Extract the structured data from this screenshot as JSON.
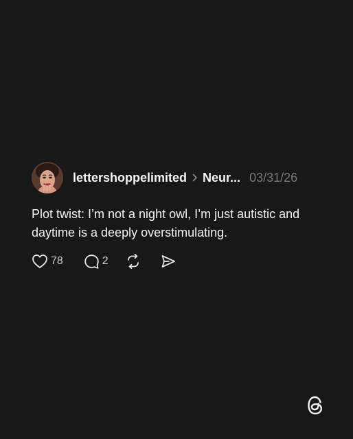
{
  "post": {
    "avatar_icon": "profile-photo",
    "username": "lettershoppelimited",
    "separator_icon": "chevron-right-icon",
    "community": "Neur...",
    "date": "03/31/26",
    "text": "Plot twist: I’m not a night owl, I’m just autistic and daytime is a deeply overstimulating.",
    "actions": {
      "like_icon": "heart-icon",
      "like_count": "78",
      "reply_icon": "comment-icon",
      "reply_count": "2",
      "repost_icon": "repost-icon",
      "share_icon": "share-icon"
    }
  },
  "branding": {
    "logo_icon": "threads-logo-icon"
  },
  "colors": {
    "background": "#181818",
    "text_primary": "#f3f5f7",
    "text_secondary": "#777777"
  }
}
